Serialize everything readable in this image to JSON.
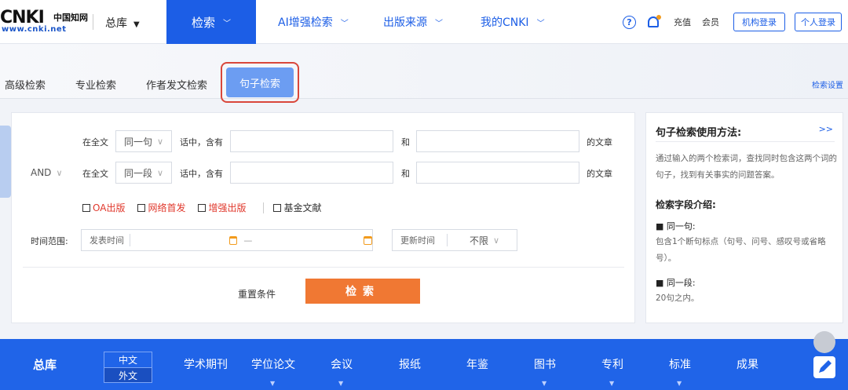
{
  "header": {
    "logo_big": "CNKI",
    "logo_cn": "中国知网",
    "logo_url": "www.cnki.net",
    "zongku": "总库",
    "nav": [
      {
        "label": "检索",
        "active": true
      },
      {
        "label": "AI增强检索"
      },
      {
        "label": "出版来源"
      },
      {
        "label": "我的CNKI"
      }
    ],
    "help_icon": "?",
    "recharge": "充值",
    "member": "会员",
    "org_login": "机构登录",
    "personal_login": "个人登录"
  },
  "tabs": {
    "items": [
      "高级检索",
      "专业检索",
      "作者发文检索",
      "句子检索"
    ],
    "active": "句子检索",
    "settings": "检索设置"
  },
  "form": {
    "row1": {
      "scope_label": "在全文",
      "unit": "同一句",
      "contains": "话中，含有",
      "and": "和",
      "suffix": "的文章",
      "value1": "",
      "value2": ""
    },
    "row2": {
      "logic": "AND",
      "scope_label": "在全文",
      "unit": "同一段",
      "contains": "话中，含有",
      "and": "和",
      "suffix": "的文章",
      "value1": "",
      "value2": ""
    },
    "checks": [
      {
        "label": "OA出版",
        "red": true
      },
      {
        "label": "网络首发",
        "red": true
      },
      {
        "label": "增强出版",
        "red": true
      },
      {
        "label": "基金文献",
        "red": false
      }
    ],
    "time_label": "时间范围:",
    "publish_label": "发表时间",
    "range_sep": "—",
    "update_label": "更新时间",
    "update_value": "不限",
    "reset": "重置条件",
    "search": "检索"
  },
  "help": {
    "title": "句子检索使用方法:",
    "more": ">>",
    "desc": "通过输入的两个检索词，查找同时包含这两个词的句子，找到有关事实的问题答案。",
    "fields_title": "检索字段介绍:",
    "f1_title": "■ 同一句:",
    "f1_text": "包含1个断句标点（句号、问号、感叹号或省略号）。",
    "f2_title": "■ 同一段:",
    "f2_text": "20句之内。"
  },
  "bottom": {
    "zongku": "总库",
    "lang_zh": "中文",
    "lang_en": "外文",
    "items": [
      "学术期刊",
      "学位论文",
      "会议",
      "报纸",
      "年鉴",
      "图书",
      "专利",
      "标准",
      "成果"
    ]
  },
  "colors": {
    "primary": "#1c5ee6",
    "accent": "#f07833",
    "highlight": "#d9473b"
  }
}
